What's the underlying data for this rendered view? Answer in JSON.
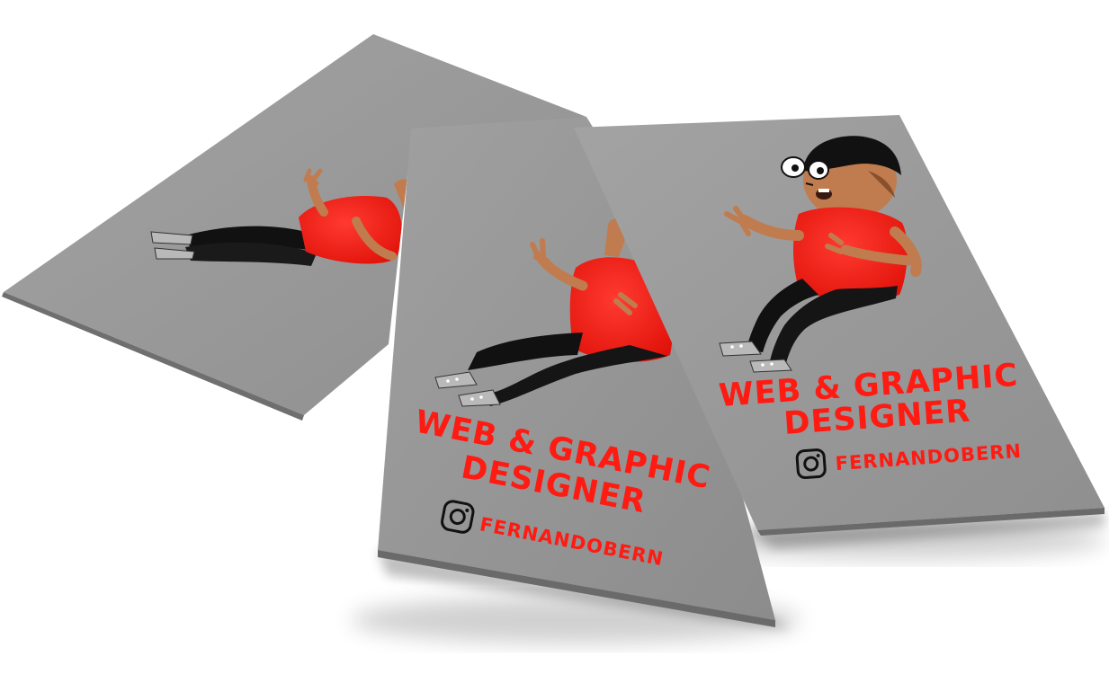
{
  "colors": {
    "card": "#9a9a9a",
    "accent": "#ff1a12",
    "ink": "#111111",
    "skin": "#c07c4e",
    "shoe": "#b9b9b9"
  },
  "cards": [
    {
      "id": "card-front",
      "tagline_line1": "WEB & GRAPHIC",
      "tagline_line2": "DESIGNER",
      "instagram_icon": "instagram-icon",
      "handle": "FERNANDOBERN"
    },
    {
      "id": "card-middle",
      "tagline_line1": "WEB & GRAPHIC",
      "tagline_line2": "DESIGNER",
      "instagram_icon": "instagram-icon",
      "handle": "FERNANDOBERN"
    },
    {
      "id": "card-back"
    }
  ]
}
